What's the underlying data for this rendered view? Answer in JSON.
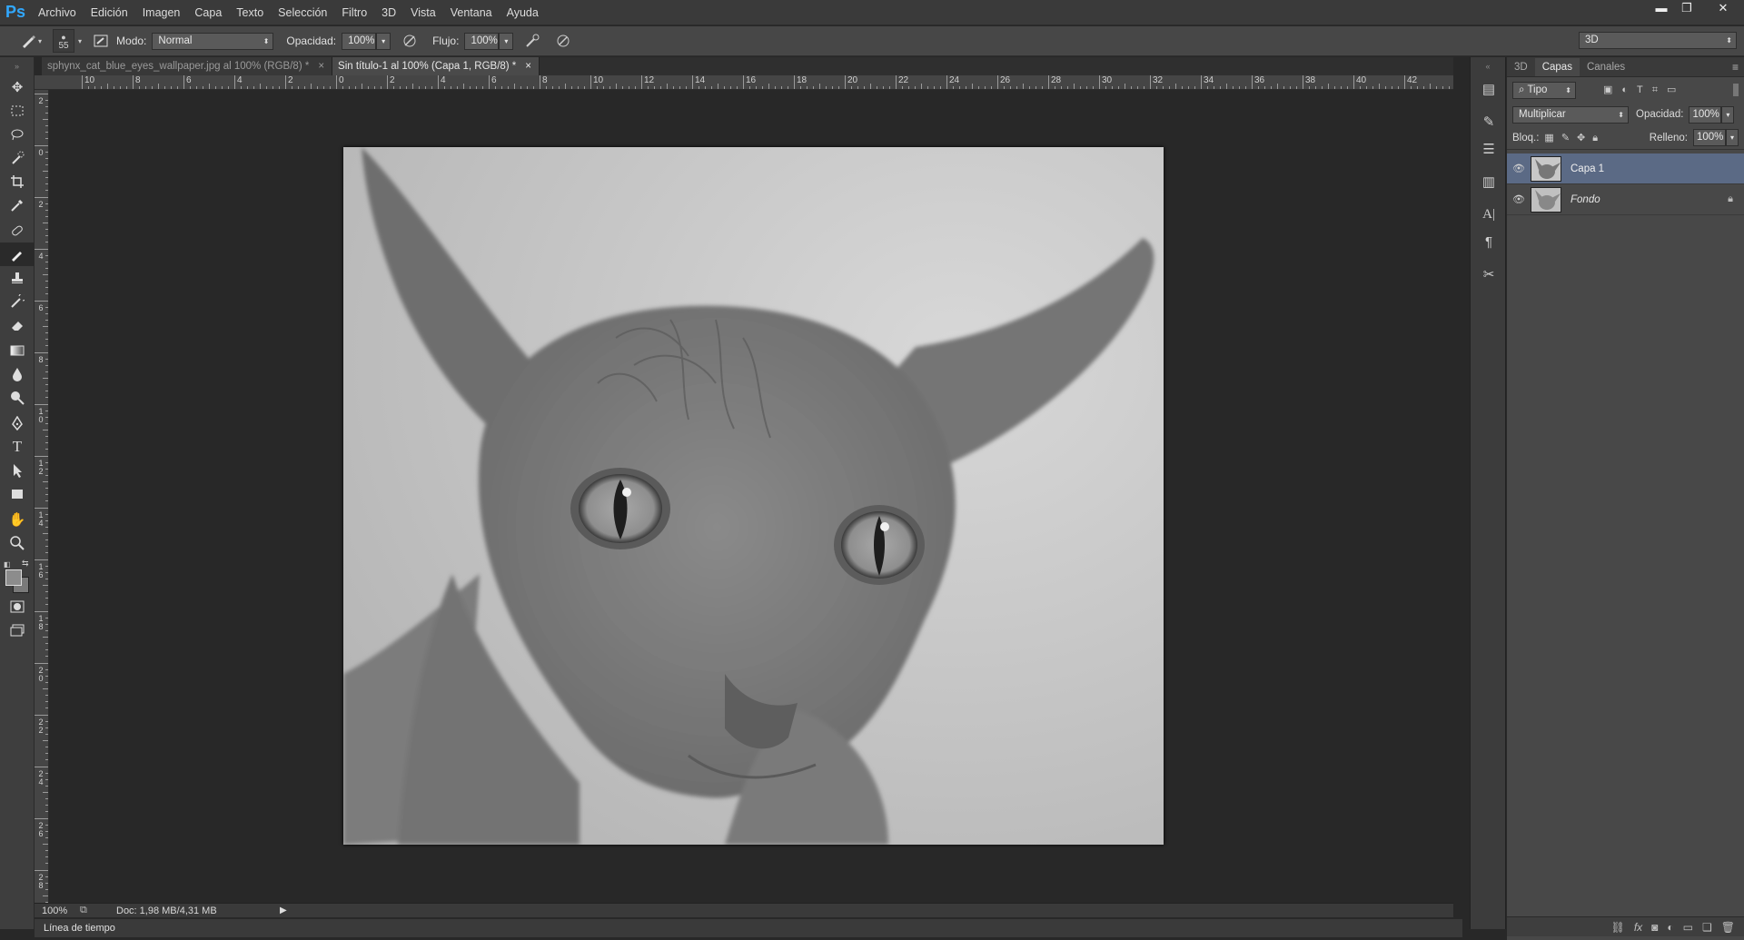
{
  "app": {
    "logo": "Ps"
  },
  "menu": [
    "Archivo",
    "Edición",
    "Imagen",
    "Capa",
    "Texto",
    "Selección",
    "Filtro",
    "3D",
    "Vista",
    "Ventana",
    "Ayuda"
  ],
  "window_controls": {
    "minimize": "▬",
    "restore": "❐",
    "close": "✕"
  },
  "options": {
    "brush_size": "55",
    "mode_label": "Modo:",
    "mode_value": "Normal",
    "opacity_label": "Opacidad:",
    "opacity_value": "100%",
    "flow_label": "Flujo:",
    "flow_value": "100%",
    "workspace_value": "3D"
  },
  "tabs": [
    {
      "label": "sphynx_cat_blue_eyes_wallpaper.jpg al 100% (RGB/8) *",
      "close": "×"
    },
    {
      "label": "Sin título-1 al 100% (Capa 1, RGB/8) *",
      "close": "×"
    }
  ],
  "ruler": {
    "h_labels": [
      "10",
      "8",
      "6",
      "4",
      "2",
      "0",
      "2",
      "4",
      "6",
      "8",
      "10",
      "12",
      "14",
      "16",
      "18",
      "20",
      "22",
      "24",
      "26",
      "28",
      "30",
      "32",
      "34",
      "36",
      "38",
      "40",
      "42"
    ],
    "v_labels": [
      "2",
      "0",
      "2",
      "4",
      "6",
      "8",
      "10",
      "12",
      "14",
      "16",
      "18",
      "20",
      "22",
      "24",
      "26",
      "28"
    ]
  },
  "status": {
    "zoom": "100%",
    "doc": "Doc: 1,98 MB/4,31 MB"
  },
  "timeline_label": "Línea de tiempo",
  "layers_panel": {
    "tabs": [
      "3D",
      "Capas",
      "Canales"
    ],
    "filter_value": "Tipo",
    "blend_value": "Multiplicar",
    "opacity_label": "Opacidad:",
    "opacity_value": "100%",
    "lock_label": "Bloq.:",
    "fill_label": "Relleno:",
    "fill_value": "100%",
    "layers": [
      {
        "name": "Capa 1",
        "selected": true
      },
      {
        "name": "Fondo",
        "selected": false,
        "locked": true
      }
    ]
  },
  "colors": {
    "accent": "#31a8ff",
    "selected_layer": "#5b6a85"
  }
}
